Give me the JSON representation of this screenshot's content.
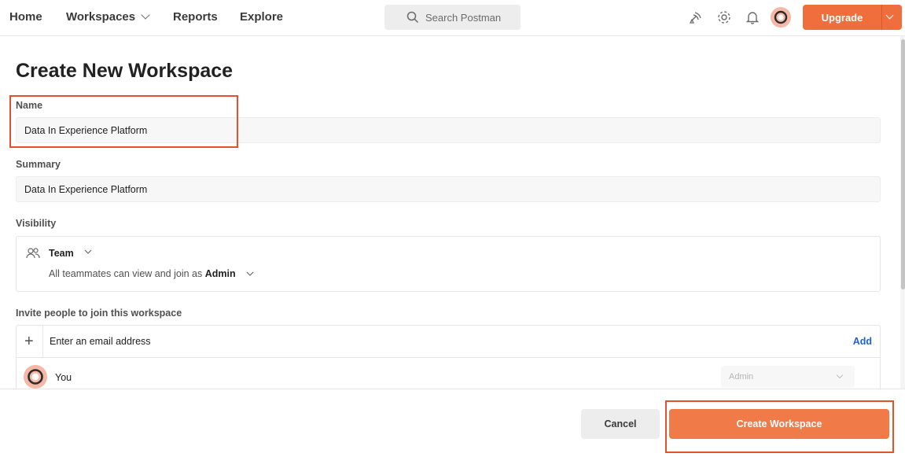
{
  "nav": {
    "home": "Home",
    "workspaces": "Workspaces",
    "reports": "Reports",
    "explore": "Explore",
    "search_placeholder": "Search Postman",
    "upgrade_label": "Upgrade"
  },
  "page": {
    "title": "Create New Workspace"
  },
  "form": {
    "name_label": "Name",
    "name_value": "Data In Experience Platform",
    "summary_label": "Summary",
    "summary_value": "Data In Experience Platform",
    "visibility_label": "Visibility",
    "visibility": {
      "option": "Team",
      "description": "All teammates can view and join as",
      "role": "Admin"
    },
    "invite": {
      "label": "Invite people to join this workspace",
      "email_placeholder": "Enter an email address",
      "add_label": "Add",
      "members": [
        {
          "name": "You",
          "role": "Admin"
        }
      ]
    }
  },
  "footer": {
    "cancel_label": "Cancel",
    "create_label": "Create Workspace"
  },
  "colors": {
    "accent": "#f06d3c",
    "highlight": "#e2532d",
    "link": "#1f63c6"
  }
}
